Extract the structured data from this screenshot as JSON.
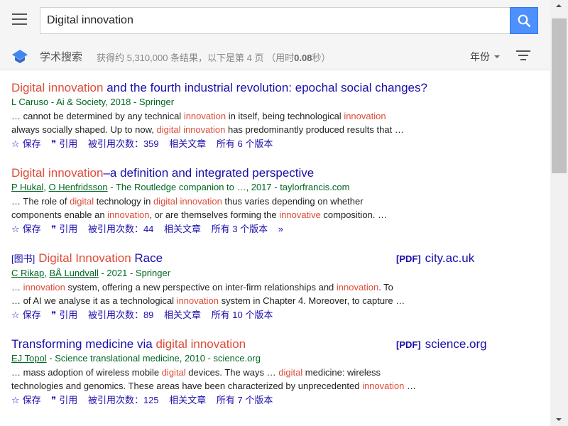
{
  "search": {
    "query": "Digital innovation"
  },
  "subbar": {
    "scholar_label": "学术搜索",
    "stats_prefix": "获得约 5,310,000 条结果，以下是第 4 页 （用时",
    "stats_time": "0.08",
    "stats_suffix": "秒）",
    "year_label": "年份"
  },
  "results": [
    {
      "title_hl": "Digital innovation",
      "title_rest": " and the fourth industrial revolution: epochal social changes?",
      "authors": "L Caruso - Ai & Society, 2018 - Springer",
      "snippet1": [
        [
          "… cannot be determined by any technical ",
          ""
        ],
        [
          "innovation",
          "hl"
        ],
        [
          " in itself, being technological ",
          ""
        ],
        [
          "innovation",
          "hl"
        ]
      ],
      "snippet2": [
        [
          "always socially shaped. Up to now, ",
          ""
        ],
        [
          "digital innovation",
          "hl"
        ],
        [
          " has predominantly produced results that …",
          ""
        ]
      ],
      "save": "保存",
      "cite": "引用",
      "cited_by": "被引用次数：359",
      "related": "相关文章",
      "versions": "所有 6 个版本"
    },
    {
      "title_hl": "Digital innovation",
      "title_rest": "–a definition and integrated perspective",
      "author1": "P Hukal",
      "author_sep": ", ",
      "author2": "O Henfridsson",
      "authors_rest": " - The Routledge companion to …, 2017 - taylorfrancis.com",
      "snippet1": [
        [
          "… The role of ",
          ""
        ],
        [
          "digital",
          "hl"
        ],
        [
          " technology in ",
          ""
        ],
        [
          "digital innovation",
          "hl"
        ],
        [
          " thus varies depending on whether",
          ""
        ]
      ],
      "snippet2": [
        [
          "components enable an ",
          ""
        ],
        [
          "innovation",
          "hl"
        ],
        [
          ", or are themselves forming the ",
          ""
        ],
        [
          "innovative",
          "hl"
        ],
        [
          " composition. …",
          ""
        ]
      ],
      "save": "保存",
      "cite": "引用",
      "cited_by": "被引用次数：44",
      "related": "相关文章",
      "versions": "所有 3 个版本"
    },
    {
      "tag": "[图书]",
      "title_hl": "Digital Innovation",
      "title_rest": " Race",
      "side_pdf": "[PDF]",
      "side_site": "city.ac.uk",
      "author1": "C Rikap",
      "author_sep": ", ",
      "author2": "BÅ Lundvall",
      "authors_rest": " - 2021 - Springer",
      "snippet1": [
        [
          "… ",
          ""
        ],
        [
          "innovation",
          "hl"
        ],
        [
          " system, offering a new perspective on inter-firm relationships and ",
          ""
        ],
        [
          "innovation",
          "hl"
        ],
        [
          ". To",
          ""
        ]
      ],
      "snippet2": [
        [
          "… of AI we analyse it as a technological ",
          ""
        ],
        [
          "innovation",
          "hl"
        ],
        [
          " system in Chapter 4. Moreover, to capture …",
          ""
        ]
      ],
      "save": "保存",
      "cite": "引用",
      "cited_by": "被引用次数：89",
      "related": "相关文章",
      "versions": "所有 10 个版本"
    },
    {
      "title_pre": "Transforming medicine via ",
      "title_hl": "digital innovation",
      "side_pdf": "[PDF]",
      "side_site": "science.org",
      "author1": "EJ Topol",
      "authors_rest": " - Science translational medicine, 2010 - science.org",
      "snippet1": [
        [
          "… mass adoption of wireless mobile ",
          ""
        ],
        [
          "digital",
          "hl"
        ],
        [
          " devices. The ways … ",
          ""
        ],
        [
          "digital",
          "hl"
        ],
        [
          " medicine: wireless",
          ""
        ]
      ],
      "snippet2": [
        [
          "technologies and genomics. These areas have been characterized by unprecedented ",
          ""
        ],
        [
          "innovation",
          "hl"
        ],
        [
          " …",
          ""
        ]
      ],
      "save": "保存",
      "cite": "引用",
      "cited_by": "被引用次数：125",
      "related": "相关文章",
      "versions": "所有 7 个版本"
    }
  ],
  "icons": {
    "menu": "hamburger-menu-icon",
    "search": "magnifier-icon",
    "logo": "scholar-cap-icon",
    "filter": "filter-lines-icon",
    "save": "star-icon",
    "cite": "quote-icon",
    "more": "double-chevron-icon"
  },
  "colors": {
    "link": "#1a0dab",
    "highlight": "#dd4b39",
    "green": "#006621",
    "search_button": "#4d90fe"
  }
}
